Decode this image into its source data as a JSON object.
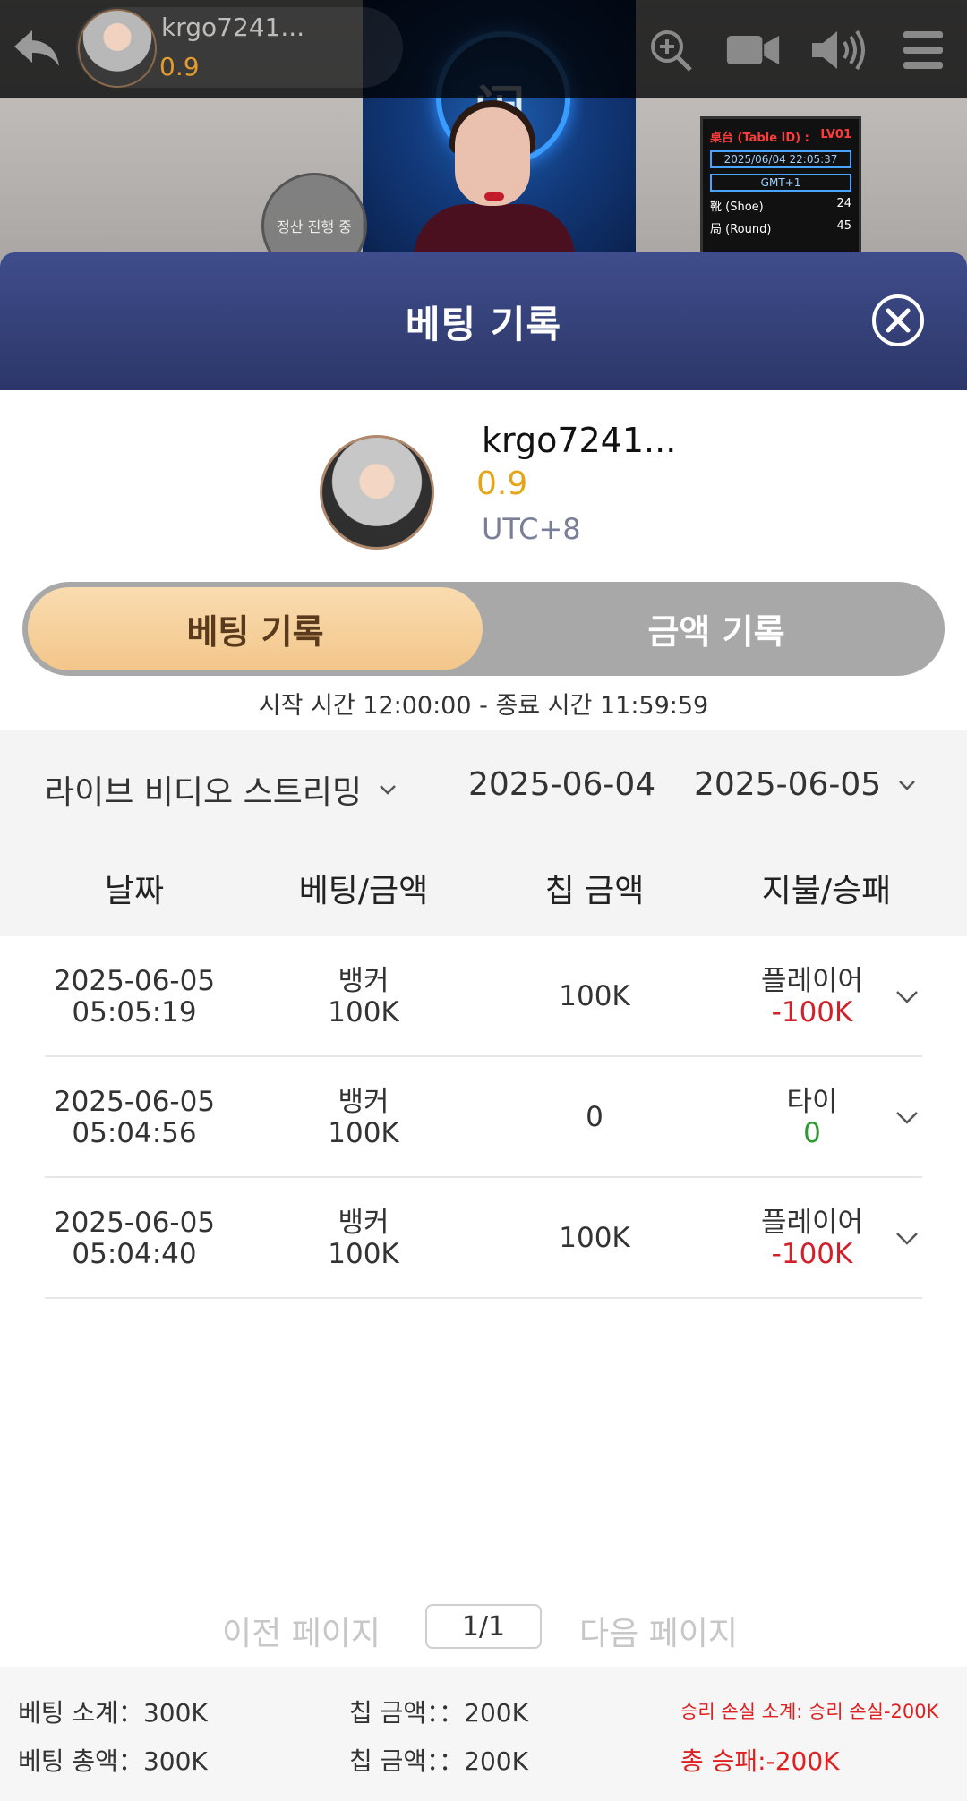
{
  "topbar": {
    "username": "krgo7241...",
    "balance": "0.9"
  },
  "video": {
    "settlement_label": "정산 진행 중",
    "board": {
      "table_label": "桌台 (Table ID) :",
      "table_id": "LV01",
      "datetime": "2025/06/04 22:05:37",
      "timezone": "GMT+1",
      "shoe_label": "靴 (Shoe)",
      "shoe_value": "24",
      "round_label": "局 (Round)",
      "round_value": "45"
    }
  },
  "modal": {
    "title": "베팅 기록",
    "profile": {
      "username": "krgo7241...",
      "balance": "0.9",
      "timezone": "UTC+8"
    },
    "tabs": {
      "active": "베팅 기록",
      "inactive": "금액 기록"
    },
    "time_range": "시작 시간 12:00:00 - 종료 시간 11:59:59",
    "filters": {
      "game_type": "라이브 비디오 스트리밍",
      "start_date": "2025-06-04",
      "end_date": "2025-06-05"
    },
    "table_headers": [
      "날짜",
      "베팅/금액",
      "칩 금액",
      "지불/승패"
    ],
    "rows": [
      {
        "date": "2025-06-05",
        "time": "05:05:19",
        "bet": "뱅커",
        "amount": "100K",
        "chip": "100K",
        "result": "플레이어",
        "payout": "-100K",
        "payout_type": "neg"
      },
      {
        "date": "2025-06-05",
        "time": "05:04:56",
        "bet": "뱅커",
        "amount": "100K",
        "chip": "0",
        "result": "타이",
        "payout": "0",
        "payout_type": "zero"
      },
      {
        "date": "2025-06-05",
        "time": "05:04:40",
        "bet": "뱅커",
        "amount": "100K",
        "chip": "100K",
        "result": "플레이어",
        "payout": "-100K",
        "payout_type": "neg"
      }
    ],
    "pager": {
      "prev": "이전 페이지",
      "page": "1/1",
      "next": "다음 페이지"
    },
    "summary": {
      "bet_subtotal": "베팅 소계：300K",
      "chip_subtotal": "칩 금액：：200K",
      "winloss_subtotal": "승리 손실 소계: 승리 손실-200K",
      "bet_total": "베팅 총액：300K",
      "chip_total": "칩 금액：：200K",
      "winloss_total": "총 승패:-200K"
    }
  }
}
